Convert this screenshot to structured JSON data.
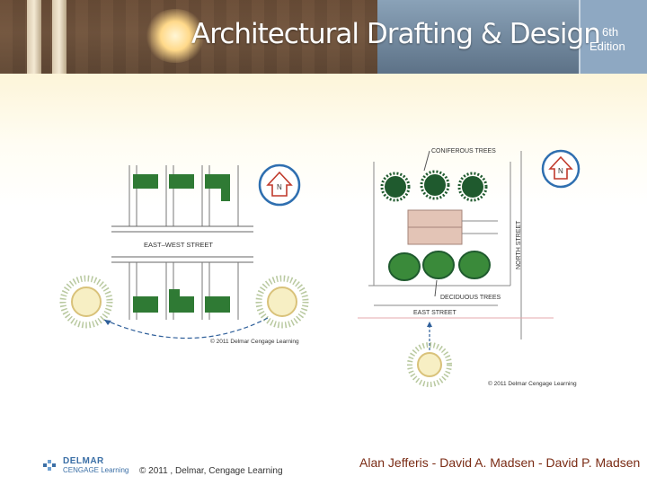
{
  "header": {
    "title": "Architectural Drafting & Design",
    "edition_number": "6th",
    "edition_word": "Edition"
  },
  "figure_left": {
    "street_label": "EAST–WEST STREET",
    "north_label": "N",
    "copyright": "© 2011 Delmar Cengage Learning"
  },
  "figure_right": {
    "coniferous_label": "CONIFEROUS TREES",
    "deciduous_label": "DECIDUOUS TREES",
    "north_street_label": "NORTH STREET",
    "east_street_label": "EAST STREET",
    "north_label": "N",
    "copyright": "© 2011 Delmar Cengage Learning"
  },
  "footer": {
    "logo_top": "DELMAR",
    "logo_bottom": "CENGAGE Learning",
    "copyright": "© 2011 , Delmar, Cengage Learning",
    "authors": "Alan Jefferis - David A. Madsen - David P. Madsen"
  },
  "colors": {
    "building_green": "#2f7a34",
    "north_arrow_red": "#c0392b",
    "north_circle_blue": "#2f6fb0",
    "footer_author_brown": "#7a2b14",
    "logo_blue": "#3b6fa6"
  }
}
